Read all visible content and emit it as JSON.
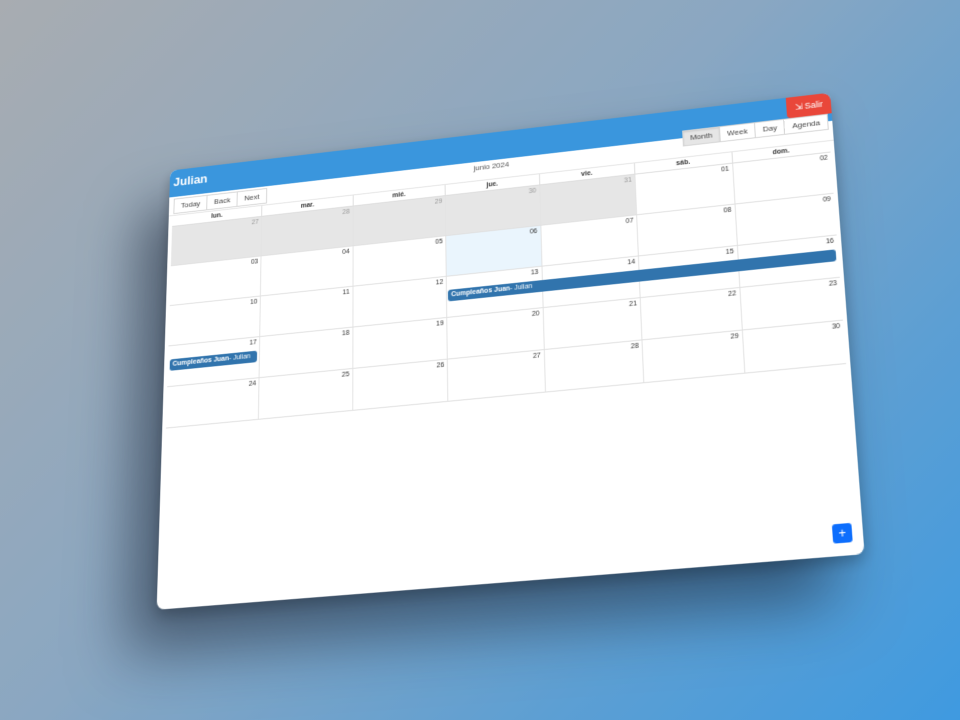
{
  "app": {
    "title": "Julian",
    "logout_label": "Salir",
    "logout_icon": "logout-icon"
  },
  "toolbar": {
    "today_label": "Today",
    "back_label": "Back",
    "next_label": "Next",
    "current_label": "junio 2024",
    "views": [
      "Month",
      "Week",
      "Day",
      "Agenda"
    ],
    "active_view": "Month"
  },
  "calendar": {
    "weekdays": [
      "lun.",
      "mar.",
      "mié.",
      "jue.",
      "vie.",
      "sáb.",
      "dom."
    ],
    "weeks": [
      {
        "days": [
          {
            "num": "27",
            "off": true
          },
          {
            "num": "28",
            "off": true
          },
          {
            "num": "29",
            "off": true
          },
          {
            "num": "30",
            "off": true
          },
          {
            "num": "31",
            "off": true
          },
          {
            "num": "01"
          },
          {
            "num": "02"
          }
        ]
      },
      {
        "days": [
          {
            "num": "03"
          },
          {
            "num": "04"
          },
          {
            "num": "05"
          },
          {
            "num": "06",
            "today": true
          },
          {
            "num": "07"
          },
          {
            "num": "08"
          },
          {
            "num": "09"
          }
        ]
      },
      {
        "days": [
          {
            "num": "10"
          },
          {
            "num": "11"
          },
          {
            "num": "12"
          },
          {
            "num": "13"
          },
          {
            "num": "14"
          },
          {
            "num": "15"
          },
          {
            "num": "16"
          }
        ],
        "event": {
          "title": "Cumpleaños Juan",
          "user": "Julian",
          "start": 3,
          "span": 4
        }
      },
      {
        "days": [
          {
            "num": "17"
          },
          {
            "num": "18"
          },
          {
            "num": "19"
          },
          {
            "num": "20"
          },
          {
            "num": "21"
          },
          {
            "num": "22"
          },
          {
            "num": "23"
          }
        ],
        "event": {
          "title": "Cumpleaños Juan",
          "user": "Julian",
          "start": 0,
          "span": 1
        }
      },
      {
        "days": [
          {
            "num": "24"
          },
          {
            "num": "25"
          },
          {
            "num": "26"
          },
          {
            "num": "27"
          },
          {
            "num": "28"
          },
          {
            "num": "29"
          },
          {
            "num": "30"
          }
        ]
      }
    ]
  },
  "fab": {
    "label": "+"
  },
  "colors": {
    "header": "#3a96dd",
    "logout": "#e9473a",
    "event": "#3174ad",
    "fab": "#0d6efd",
    "today": "#eaf5fd",
    "off_range": "#e6e6e6"
  }
}
